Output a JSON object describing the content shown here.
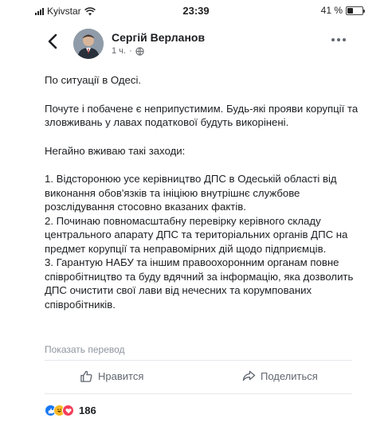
{
  "status_bar": {
    "carrier": "Kyivstar",
    "time": "23:39",
    "battery": "41 %",
    "battery_level": 0.41
  },
  "post": {
    "author": "Сергій Верланов",
    "time_ago": "1 ч.",
    "privacy_icon": "globe-icon",
    "paragraphs": [
      "По ситуації в Одесі.",
      "Почуте і побачене є неприпустимим. Будь-які прояви корупції та зловживань у лавах податкової будуть викорінені.",
      "Негайно вживаю такі заходи:",
      "1. Відсторонюю усе керівництво ДПС в Одеській області від виконання обов'язків та ініціюю внутрішнє службове розслідування стосовно вказаних фактів.",
      "2. Починаю повномасштабну перевірку керівного складу центрального апарату ДПС та територіальних органів ДПС на предмет корупції та неправомірних дій щодо підприємців.",
      "3. Гарантую НАБУ та іншим правоохоронним органам повне співробітництво та буду вдячний за інформацію, яка дозволить ДПС очистити свої лави від нечесних та корумпованих співробітників."
    ],
    "translate_link": "Показать перевод"
  },
  "actions": {
    "like_label": "Нравится",
    "share_label": "Поделиться"
  },
  "reactions": {
    "icons": [
      "like-icon",
      "haha-icon",
      "love-icon"
    ],
    "count": "186"
  },
  "colors": {
    "text": "#1c1e21",
    "secondary": "#65676b",
    "like_blue": "#1877f2",
    "love_red": "#f33e58",
    "haha_yellow": "#f7b928"
  }
}
